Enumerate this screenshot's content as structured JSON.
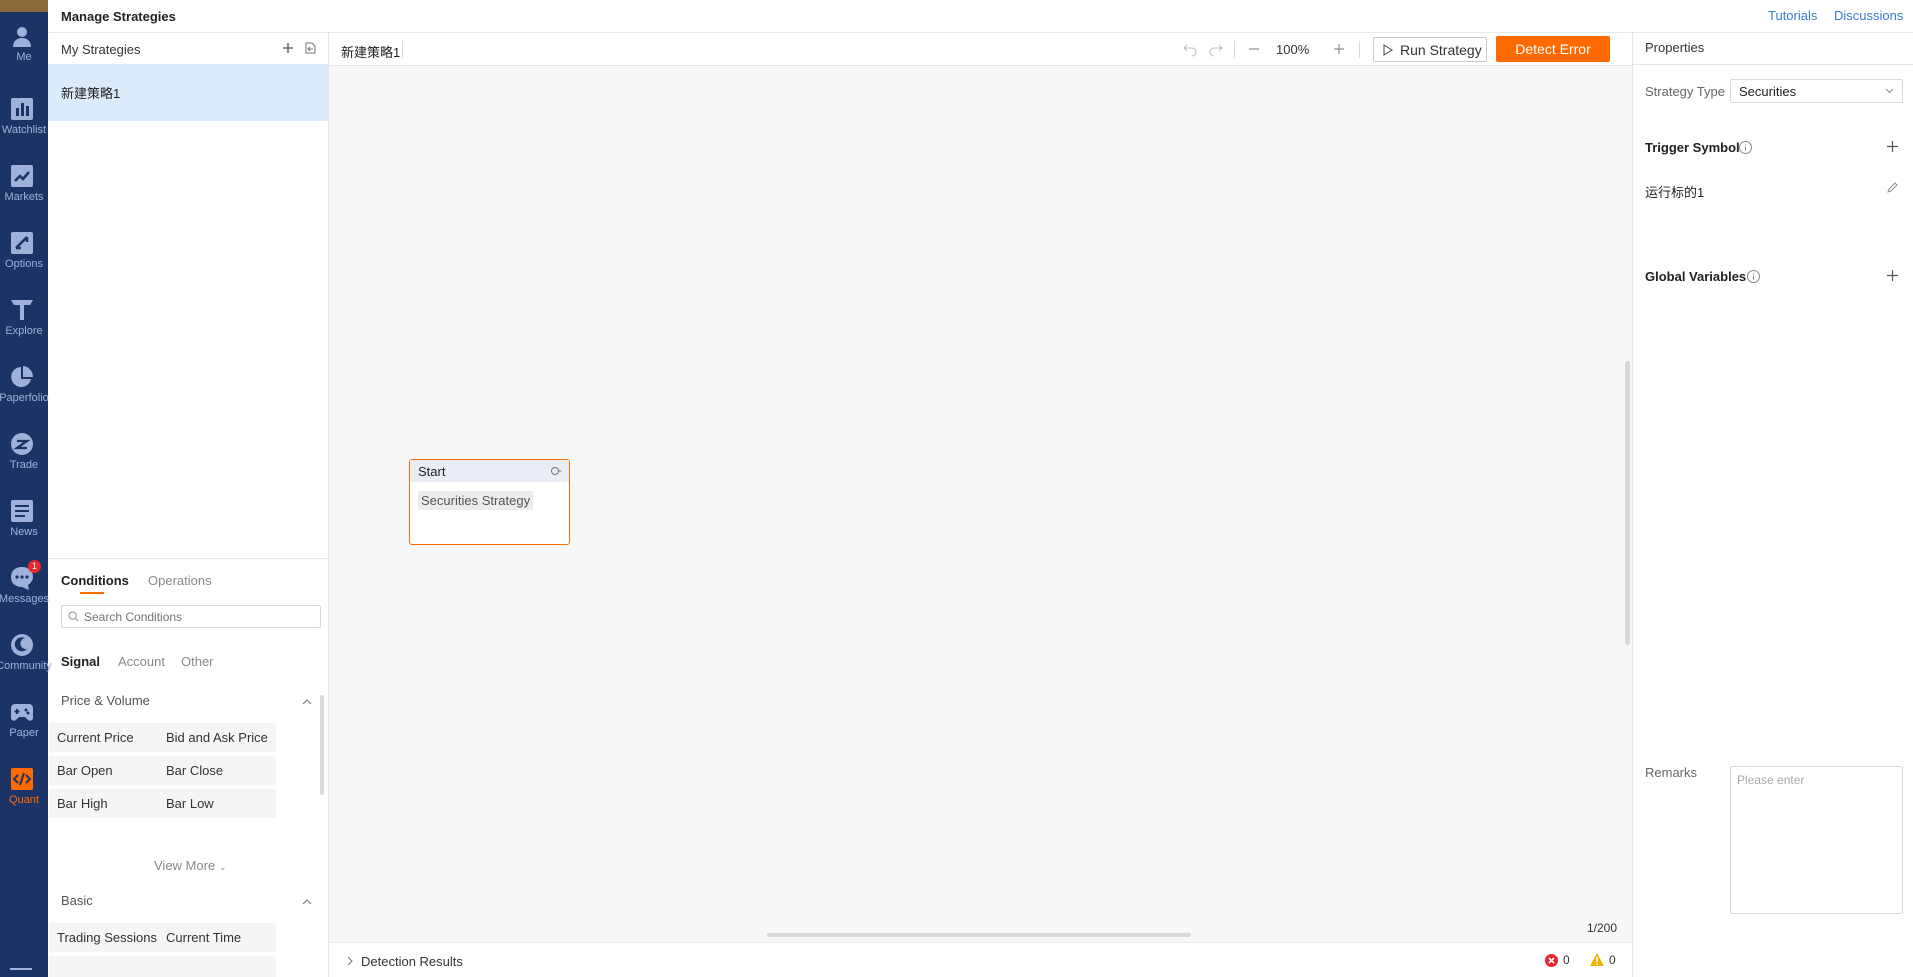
{
  "nav": {
    "items": [
      {
        "label": "Me",
        "icon": "person-icon"
      },
      {
        "label": "Watchlist",
        "icon": "bar-chart-icon"
      },
      {
        "label": "Markets",
        "icon": "trend-icon"
      },
      {
        "label": "Options",
        "icon": "options-icon"
      },
      {
        "label": "Explore",
        "icon": "filter-icon"
      },
      {
        "label": "Paperfolio",
        "icon": "pie-icon"
      },
      {
        "label": "Trade",
        "icon": "trade-icon"
      },
      {
        "label": "News",
        "icon": "news-icon"
      },
      {
        "label": "Messages",
        "icon": "chat-icon",
        "badge": "1"
      },
      {
        "label": "Community",
        "icon": "community-icon"
      },
      {
        "label": "Paper",
        "icon": "gamepad-icon"
      },
      {
        "label": "Quant",
        "icon": "code-icon",
        "active": true
      }
    ],
    "accent": "#ff6a00",
    "bg": "#1c3366"
  },
  "header": {
    "title": "Manage Strategies",
    "links": [
      "Tutorials",
      "Discussions"
    ]
  },
  "strategies": {
    "heading": "My Strategies",
    "items": [
      "新建策略1"
    ]
  },
  "conditions": {
    "tabs": [
      "Conditions",
      "Operations"
    ],
    "search_placeholder": "Search Conditions",
    "subtabs": [
      "Signal",
      "Account",
      "Other"
    ],
    "sections": [
      {
        "title": "Price & Volume",
        "items": [
          "Current Price",
          "Bid and Ask Price",
          "Bar Open",
          "Bar Close",
          "Bar High",
          "Bar Low"
        ],
        "more": "View More"
      },
      {
        "title": "Basic",
        "items": [
          "Trading Sessions",
          "Current Time"
        ]
      }
    ]
  },
  "toolbar": {
    "file_name": "新建策略1",
    "zoom": "100%",
    "run_label": "Run Strategy",
    "detect_label": "Detect Error"
  },
  "canvas": {
    "node": {
      "title": "Start",
      "tag": "Securities Strategy"
    },
    "page_count": "1/200"
  },
  "detection": {
    "label": "Detection Results",
    "errors": "0",
    "warnings": "0"
  },
  "properties": {
    "heading": "Properties",
    "strategy_type_label": "Strategy Type",
    "strategy_type_value": "Securities",
    "trigger_symbol": "Trigger Symbol",
    "symbol": "运行标的1",
    "global_variables": "Global Variables",
    "remarks_label": "Remarks",
    "remarks_placeholder": "Please enter"
  }
}
